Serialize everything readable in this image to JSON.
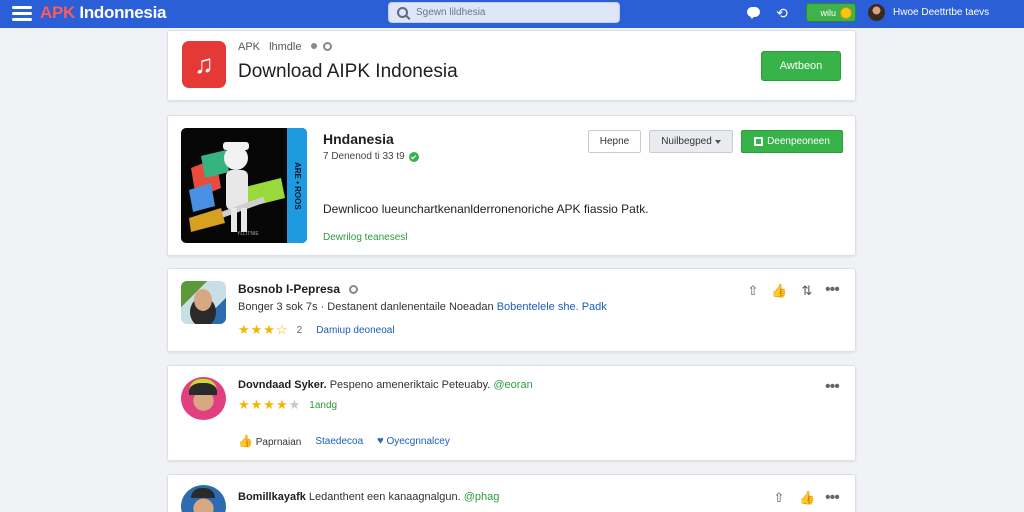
{
  "topbar": {
    "logo_accent": "APK",
    "logo_rest": " Indonnesia",
    "search_placeholder": "Sgewn lildhesia",
    "coins": "wilu",
    "user_name": "Hwoe Deettrtbe taevs",
    "accent_color": "#2b5fd8"
  },
  "header": {
    "crumb": "APK",
    "crumb_sub": "lhmdle",
    "title": "Download AIPK Indonesia",
    "button": "Awtbeon",
    "icon": "music-note-icon"
  },
  "featured": {
    "image_tag": "YLLITNIE",
    "stripe_text": "ARE • ROOS",
    "title": "Hndanesia",
    "meta": "7 Denenod ti 33 t9",
    "description": "Dewnlicoo lueunchartkenanlderronenoriche APK fiassio Patk.",
    "link": "Dewrilog teanesesl",
    "btn_help": "Hepne",
    "btn_select": "Nuilbegped",
    "btn_green": "Deenpeoneen"
  },
  "posts": [
    {
      "name": "Bosnob I-Pepresa",
      "subtitle_meta": "Bonger 3 sok 7s",
      "subtitle_text": " · Destanent danlenentaile Noeadan ",
      "subtitle_link": "Bobentelele she. Padk",
      "rating": 3.5,
      "rating_count": "2",
      "link": "Damiup deoneoal"
    },
    {
      "name": "Dovndaad Syker.",
      "text": " Pespeno ameneriktaic Peteuaby. ",
      "mention": "@eoran",
      "rating": 4,
      "rating_text": "1andg",
      "like_label": "Paprnaian",
      "action_label": "Staedecoa",
      "action2_label": "Oyecgnnalcey"
    },
    {
      "name": "Bomillkayafk",
      "text": " Ledanthent een kanaagnalgun. ",
      "mention": "@phag"
    }
  ]
}
